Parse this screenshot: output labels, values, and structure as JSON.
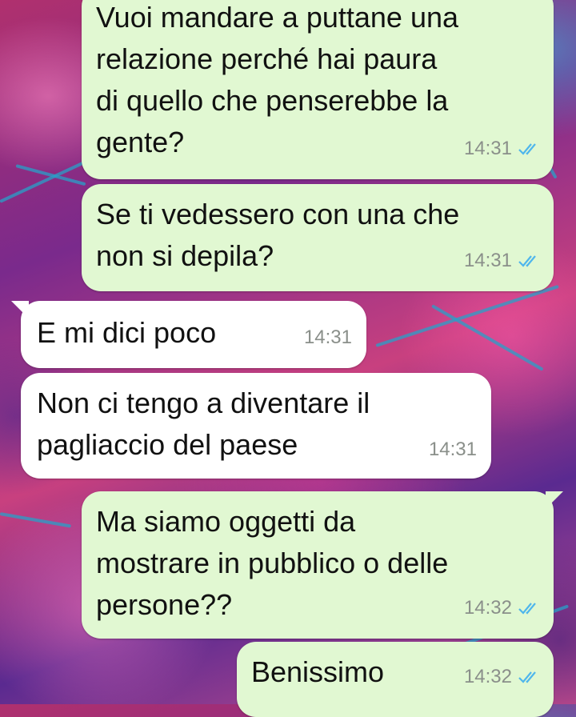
{
  "messages": [
    {
      "direction": "outgoing",
      "text": "Vuoi mandare a puttane una\nrelazione perché hai paura\ndi quello che penserebbe la\ngente?",
      "time": "14:31",
      "status": "read-double-check-icon"
    },
    {
      "direction": "outgoing",
      "text": "Se ti vedessero con una che\nnon si depila?",
      "time": "14:31",
      "status": "read-double-check-icon"
    },
    {
      "direction": "incoming",
      "text": "E mi dici poco",
      "time": "14:31"
    },
    {
      "direction": "incoming",
      "text": "Non ci tengo a diventare il\npagliaccio del paese",
      "time": "14:31"
    },
    {
      "direction": "outgoing",
      "text": "Ma siamo oggetti da\nmostrare in pubblico o delle\npersone??",
      "time": "14:32",
      "status": "read-double-check-icon"
    },
    {
      "direction": "outgoing",
      "text": "Benissimo",
      "time": "14:32",
      "status": "read-double-check-icon"
    }
  ],
  "colors": {
    "outgoing_bubble": "#e1f8d2",
    "incoming_bubble": "#ffffff",
    "read_tick": "#4fb6ec",
    "time_text": "#8a8f8a"
  }
}
